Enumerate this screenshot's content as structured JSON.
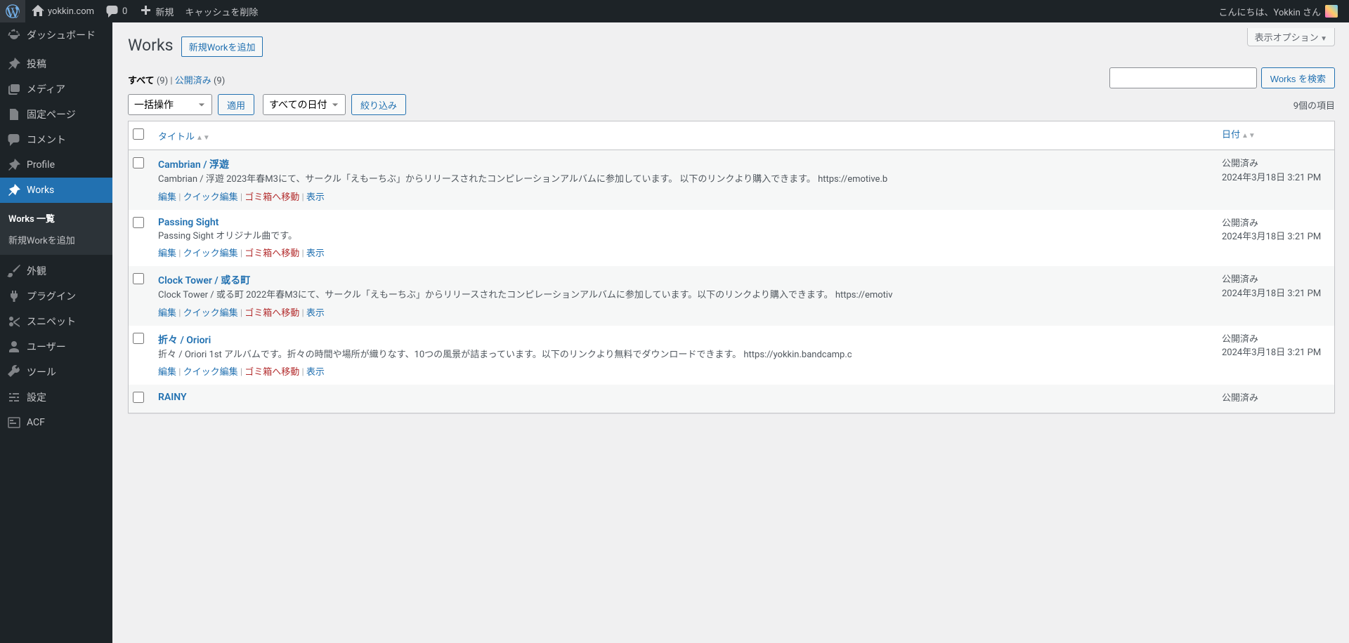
{
  "adminbar": {
    "site": "yokkin.com",
    "comments": "0",
    "new": "新規",
    "cache": "キャッシュを削除",
    "howdy": "こんにちは、Yokkin さん"
  },
  "menu": {
    "dashboard": "ダッシュボード",
    "posts": "投稿",
    "media": "メディア",
    "pages": "固定ページ",
    "comments": "コメント",
    "profile": "Profile",
    "works": "Works",
    "works_list": "Works 一覧",
    "works_new": "新規Workを追加",
    "appearance": "外観",
    "plugins": "プラグイン",
    "snippets": "スニペット",
    "users": "ユーザー",
    "tools": "ツール",
    "settings": "設定",
    "acf": "ACF"
  },
  "page": {
    "title": "Works",
    "add_new": "新規Workを追加",
    "screen_options": "表示オプション"
  },
  "filters": {
    "all": "すべて",
    "all_count": "(9)",
    "published": "公開済み",
    "published_count": "(9)",
    "bulk": "一括操作",
    "apply": "適用",
    "all_dates": "すべての日付",
    "filter": "絞り込み",
    "search_btn": "Works を検索",
    "items_count": "9個の項目"
  },
  "columns": {
    "title": "タイトル",
    "date": "日付"
  },
  "actions": {
    "edit": "編集",
    "quick": "クイック編集",
    "trash": "ゴミ箱へ移動",
    "view": "表示"
  },
  "rows": [
    {
      "title": "Cambrian / 浮遊",
      "excerpt": "Cambrian / 浮遊 2023年春M3にて、サークル「えもーちぶ」からリリースされたコンピレーションアルバムに参加しています。 以下のリンクより購入できます。 https://emotive.b",
      "status": "公開済み",
      "date": "2024年3月18日 3:21 PM"
    },
    {
      "title": "Passing Sight",
      "excerpt": "Passing Sight オリジナル曲です。",
      "status": "公開済み",
      "date": "2024年3月18日 3:21 PM"
    },
    {
      "title": "Clock Tower / 或る町",
      "excerpt": "Clock Tower / 或る町 2022年春M3にて、サークル「えもーちぶ」からリリースされたコンピレーションアルバムに参加しています。以下のリンクより購入できます。 https://emotiv",
      "status": "公開済み",
      "date": "2024年3月18日 3:21 PM"
    },
    {
      "title": "折々 / Oriori",
      "excerpt": "折々 / Oriori 1st アルバムです。折々の時間や場所が織りなす、10つの風景が詰まっています。以下のリンクより無料でダウンロードできます。 https://yokkin.bandcamp.c",
      "status": "公開済み",
      "date": "2024年3月18日 3:21 PM"
    },
    {
      "title": "RAINY",
      "excerpt": "",
      "status": "公開済み",
      "date": ""
    }
  ]
}
